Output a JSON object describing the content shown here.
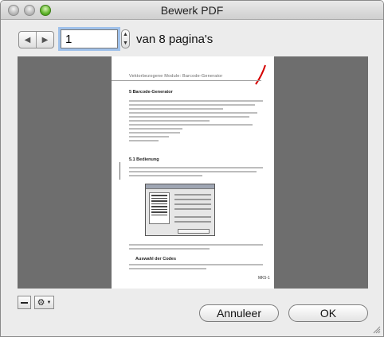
{
  "window": {
    "title": "Bewerk PDF"
  },
  "navigation": {
    "prev_icon": "triangle-left",
    "next_icon": "triangle-right",
    "current_page": "1",
    "page_count_label": "van 8 pagina's"
  },
  "preview": {
    "page_header": "Vektorbezogene Module: Barcode-Generator",
    "section_title": "5  Barcode-Generator",
    "subsection_title": "5.1    Bedienung",
    "subheading": "Auswahl der Codes",
    "page_number": "MK5-1"
  },
  "bottom_tools": {
    "remove_icon": "minus-icon",
    "action_icon": "gear-icon"
  },
  "buttons": {
    "cancel_label": "Annuleer",
    "ok_label": "OK"
  },
  "colors": {
    "accent": "#9fc1ea",
    "preview_background": "#6e6e6e",
    "zoom_button": "#5fb42b"
  }
}
